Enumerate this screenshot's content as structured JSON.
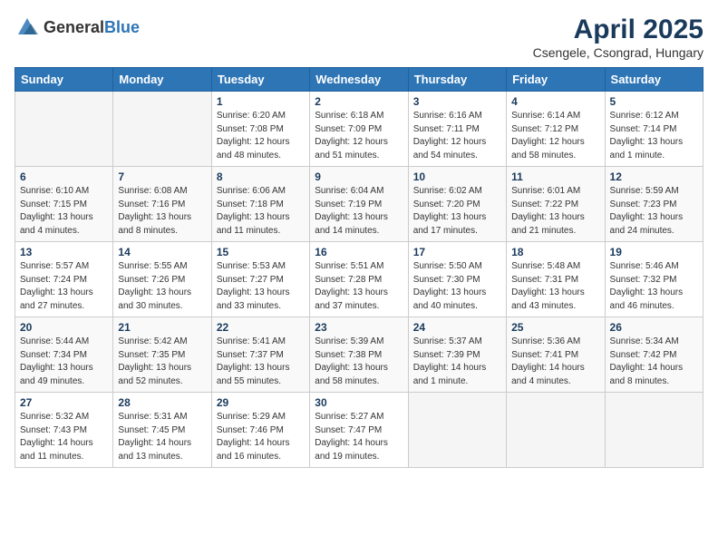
{
  "header": {
    "logo_general": "General",
    "logo_blue": "Blue",
    "month_title": "April 2025",
    "location": "Csengele, Csongrad, Hungary"
  },
  "weekdays": [
    "Sunday",
    "Monday",
    "Tuesday",
    "Wednesday",
    "Thursday",
    "Friday",
    "Saturday"
  ],
  "weeks": [
    [
      {
        "day": "",
        "detail": ""
      },
      {
        "day": "",
        "detail": ""
      },
      {
        "day": "1",
        "detail": "Sunrise: 6:20 AM\nSunset: 7:08 PM\nDaylight: 12 hours\nand 48 minutes."
      },
      {
        "day": "2",
        "detail": "Sunrise: 6:18 AM\nSunset: 7:09 PM\nDaylight: 12 hours\nand 51 minutes."
      },
      {
        "day": "3",
        "detail": "Sunrise: 6:16 AM\nSunset: 7:11 PM\nDaylight: 12 hours\nand 54 minutes."
      },
      {
        "day": "4",
        "detail": "Sunrise: 6:14 AM\nSunset: 7:12 PM\nDaylight: 12 hours\nand 58 minutes."
      },
      {
        "day": "5",
        "detail": "Sunrise: 6:12 AM\nSunset: 7:14 PM\nDaylight: 13 hours\nand 1 minute."
      }
    ],
    [
      {
        "day": "6",
        "detail": "Sunrise: 6:10 AM\nSunset: 7:15 PM\nDaylight: 13 hours\nand 4 minutes."
      },
      {
        "day": "7",
        "detail": "Sunrise: 6:08 AM\nSunset: 7:16 PM\nDaylight: 13 hours\nand 8 minutes."
      },
      {
        "day": "8",
        "detail": "Sunrise: 6:06 AM\nSunset: 7:18 PM\nDaylight: 13 hours\nand 11 minutes."
      },
      {
        "day": "9",
        "detail": "Sunrise: 6:04 AM\nSunset: 7:19 PM\nDaylight: 13 hours\nand 14 minutes."
      },
      {
        "day": "10",
        "detail": "Sunrise: 6:02 AM\nSunset: 7:20 PM\nDaylight: 13 hours\nand 17 minutes."
      },
      {
        "day": "11",
        "detail": "Sunrise: 6:01 AM\nSunset: 7:22 PM\nDaylight: 13 hours\nand 21 minutes."
      },
      {
        "day": "12",
        "detail": "Sunrise: 5:59 AM\nSunset: 7:23 PM\nDaylight: 13 hours\nand 24 minutes."
      }
    ],
    [
      {
        "day": "13",
        "detail": "Sunrise: 5:57 AM\nSunset: 7:24 PM\nDaylight: 13 hours\nand 27 minutes."
      },
      {
        "day": "14",
        "detail": "Sunrise: 5:55 AM\nSunset: 7:26 PM\nDaylight: 13 hours\nand 30 minutes."
      },
      {
        "day": "15",
        "detail": "Sunrise: 5:53 AM\nSunset: 7:27 PM\nDaylight: 13 hours\nand 33 minutes."
      },
      {
        "day": "16",
        "detail": "Sunrise: 5:51 AM\nSunset: 7:28 PM\nDaylight: 13 hours\nand 37 minutes."
      },
      {
        "day": "17",
        "detail": "Sunrise: 5:50 AM\nSunset: 7:30 PM\nDaylight: 13 hours\nand 40 minutes."
      },
      {
        "day": "18",
        "detail": "Sunrise: 5:48 AM\nSunset: 7:31 PM\nDaylight: 13 hours\nand 43 minutes."
      },
      {
        "day": "19",
        "detail": "Sunrise: 5:46 AM\nSunset: 7:32 PM\nDaylight: 13 hours\nand 46 minutes."
      }
    ],
    [
      {
        "day": "20",
        "detail": "Sunrise: 5:44 AM\nSunset: 7:34 PM\nDaylight: 13 hours\nand 49 minutes."
      },
      {
        "day": "21",
        "detail": "Sunrise: 5:42 AM\nSunset: 7:35 PM\nDaylight: 13 hours\nand 52 minutes."
      },
      {
        "day": "22",
        "detail": "Sunrise: 5:41 AM\nSunset: 7:37 PM\nDaylight: 13 hours\nand 55 minutes."
      },
      {
        "day": "23",
        "detail": "Sunrise: 5:39 AM\nSunset: 7:38 PM\nDaylight: 13 hours\nand 58 minutes."
      },
      {
        "day": "24",
        "detail": "Sunrise: 5:37 AM\nSunset: 7:39 PM\nDaylight: 14 hours\nand 1 minute."
      },
      {
        "day": "25",
        "detail": "Sunrise: 5:36 AM\nSunset: 7:41 PM\nDaylight: 14 hours\nand 4 minutes."
      },
      {
        "day": "26",
        "detail": "Sunrise: 5:34 AM\nSunset: 7:42 PM\nDaylight: 14 hours\nand 8 minutes."
      }
    ],
    [
      {
        "day": "27",
        "detail": "Sunrise: 5:32 AM\nSunset: 7:43 PM\nDaylight: 14 hours\nand 11 minutes."
      },
      {
        "day": "28",
        "detail": "Sunrise: 5:31 AM\nSunset: 7:45 PM\nDaylight: 14 hours\nand 13 minutes."
      },
      {
        "day": "29",
        "detail": "Sunrise: 5:29 AM\nSunset: 7:46 PM\nDaylight: 14 hours\nand 16 minutes."
      },
      {
        "day": "30",
        "detail": "Sunrise: 5:27 AM\nSunset: 7:47 PM\nDaylight: 14 hours\nand 19 minutes."
      },
      {
        "day": "",
        "detail": ""
      },
      {
        "day": "",
        "detail": ""
      },
      {
        "day": "",
        "detail": ""
      }
    ]
  ]
}
